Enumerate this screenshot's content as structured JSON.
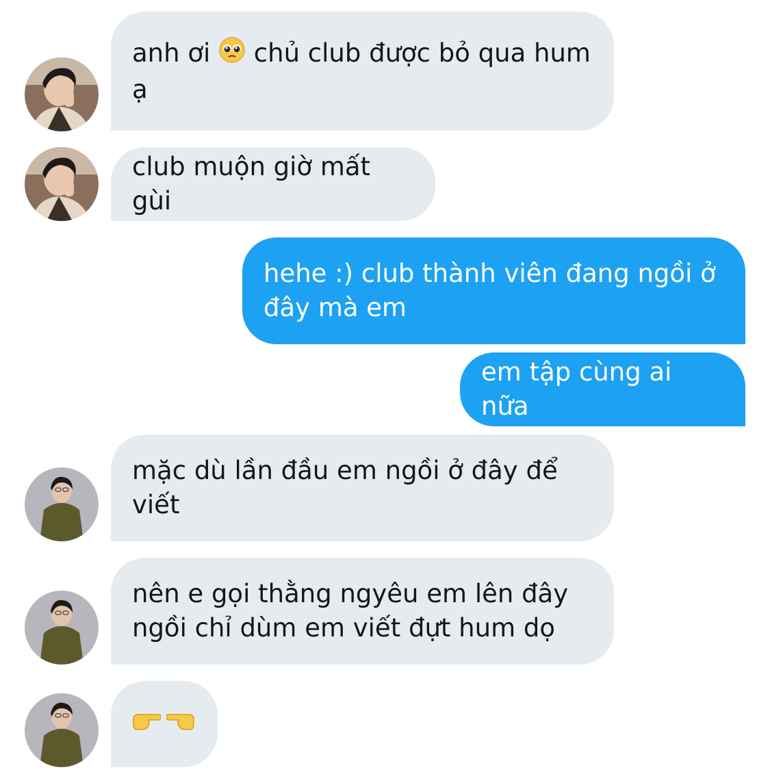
{
  "conversation": {
    "messages": [
      {
        "text_before": "anh ơi ",
        "emoji": "pleading-face-emoji",
        "text_after": " chủ club được bỏ qua hum ạ"
      },
      {
        "text": "club muộn giờ mất gùi"
      },
      {
        "text": "hehe :) club thành viên đang ngồi ở đây mà em"
      },
      {
        "text": "em tập cùng ai nữa"
      },
      {
        "text": "mặc dù lần đầu em ngồi ở đây để viết"
      },
      {
        "text": "nên e gọi thằng ngyêu em lên đây ngồi chỉ dùm em viết đựt hum dọ"
      },
      {
        "emoji": [
          "backhand-index-pointing-right-emoji",
          "backhand-index-pointing-left-emoji"
        ]
      }
    ]
  },
  "colors": {
    "incoming_bubble": "#e6ebef",
    "incoming_text": "#14171a",
    "outgoing_bubble": "#1da1f2",
    "outgoing_text": "#ffffff",
    "background": "#ffffff"
  }
}
